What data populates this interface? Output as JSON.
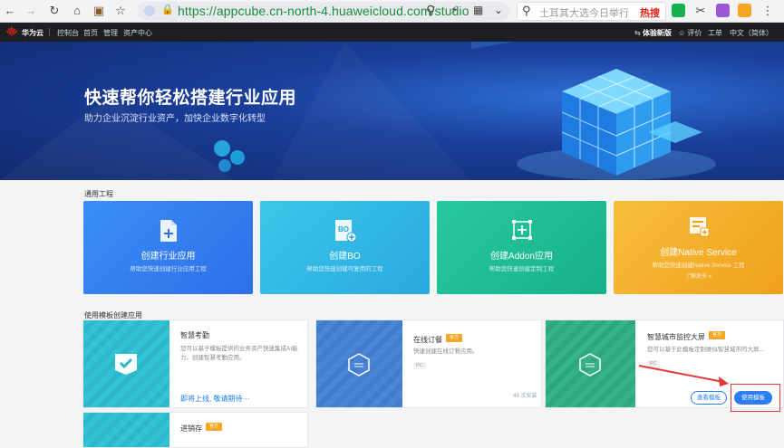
{
  "browser": {
    "url": "https://appcube.cn-north-4.huaweicloud.com/studio",
    "search_query": "土耳其大选今日举行",
    "search_hot_label": "热搜"
  },
  "nav": {
    "brand": "华为云",
    "items": [
      "控制台",
      "首页",
      "管理",
      "资产中心"
    ],
    "right": {
      "version": "体验新版",
      "feedback": "评价",
      "ticket": "工单",
      "language": "中文（简体）"
    }
  },
  "hero": {
    "title": "快速帮你轻松搭建行业应用",
    "subtitle": "助力企业沉淀行业资产，加快企业数字化转型"
  },
  "sections": {
    "projects_title": "通用工程",
    "templates_title": "使用模板创建应用"
  },
  "projects": [
    {
      "title": "创建行业应用",
      "desc": "帮助您快速创建行业应用工程",
      "color_from": "#3a8ef6",
      "color_to": "#2f6fe8"
    },
    {
      "title": "创建BO",
      "desc": "帮助您快速创建可复用的工程",
      "color_from": "#3cc6e8",
      "color_to": "#29a9e0"
    },
    {
      "title": "创建Addon应用",
      "desc": "帮助您快速创建定制工程",
      "color_from": "#27c9a0",
      "color_to": "#17b08a"
    },
    {
      "title": "创建Native Service",
      "desc": "帮助您快速创建Native Service 工程",
      "more": "了解更多 »",
      "color_from": "#f7be3c",
      "color_to": "#f0a11c"
    }
  ],
  "templates": [
    {
      "title": "智慧考勤",
      "desc": "您可以基于模板提供的业务资产快速集成AI能力、创建智慧考勤应用。",
      "link": "即将上线, 敬请期待···"
    },
    {
      "title": "在线订餐",
      "badge": "官方",
      "desc": "快速创建在线订餐应用。",
      "tag": "PC",
      "count": "49 次安装"
    },
    {
      "title": "智慧城市监控大屏",
      "badge": "官方",
      "desc": "您可以基于此模板定制类似智慧城市的大屏...",
      "tag": "PC",
      "view_label": "查看模板",
      "use_label": "使用模板"
    },
    {
      "title": "进销存",
      "badge": "官方"
    }
  ]
}
